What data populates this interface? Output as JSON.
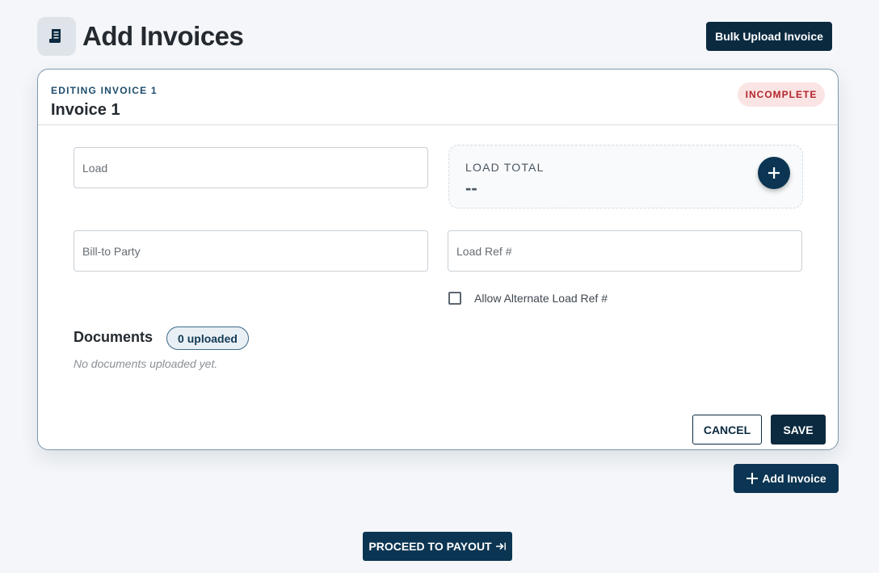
{
  "header": {
    "title": "Add Invoices",
    "title_icon": "receipt-icon",
    "bulk_upload_label": "Bulk Upload Invoice"
  },
  "invoice_card": {
    "editing_label": "EDITING INVOICE 1",
    "invoice_name": "Invoice 1",
    "status": "INCOMPLETE",
    "fields": {
      "load": {
        "placeholder": "Load",
        "value": ""
      },
      "bill_to_party": {
        "placeholder": "Bill-to Party",
        "value": ""
      },
      "load_ref": {
        "placeholder": "Load Ref #",
        "value": ""
      }
    },
    "load_total": {
      "label": "LOAD TOTAL",
      "value": "--",
      "add_icon": "plus-icon"
    },
    "allow_alternate": {
      "label": "Allow Alternate Load Ref #",
      "checked": false
    },
    "documents": {
      "title": "Documents",
      "count_label": "0 uploaded",
      "empty_text": "No documents uploaded yet."
    },
    "cancel_label": "CANCEL",
    "save_label": "SAVE"
  },
  "add_invoice_label": "Add Invoice",
  "proceed_label": "PROCEED TO PAYOUT",
  "colors": {
    "primary": "#0b2a40",
    "status_text": "#b2262b",
    "status_bg": "#fbe4e4",
    "background": "#f4f6f9"
  }
}
